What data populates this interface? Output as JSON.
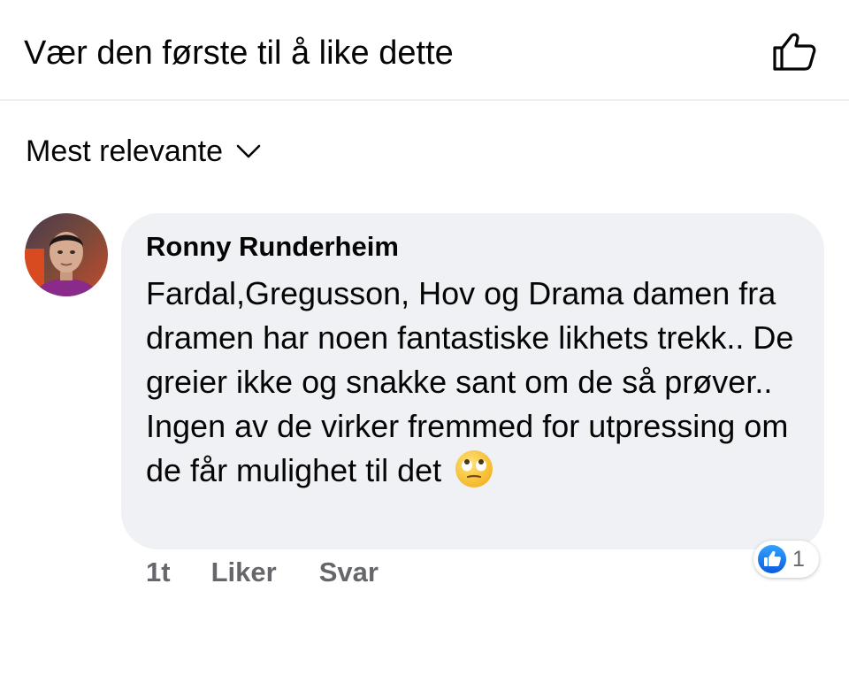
{
  "header": {
    "like_prompt": "Vær den første til å like dette",
    "like_icon": "thumbs-up-outline-icon"
  },
  "sort": {
    "label": "Mest relevante",
    "icon": "chevron-down-icon"
  },
  "comment": {
    "author": "Ronny Runderheim",
    "text": "Fardal,Gregusson, Hov og Drama damen fra dramen har noen fantastiske likhets trekk.. De greier ikke og snakke sant om de så prøver.. Ingen av de virker fremmed for utpressing om de får mulighet til det",
    "emoji": "face-with-rolling-eyes",
    "time": "1t",
    "like_label": "Liker",
    "reply_label": "Svar",
    "reaction_count": "1",
    "reaction_icon": "like-reaction-icon"
  },
  "colors": {
    "bubble_bg": "#eff1f4",
    "meta_text": "#65676b",
    "like_blue": "#1877f2"
  }
}
